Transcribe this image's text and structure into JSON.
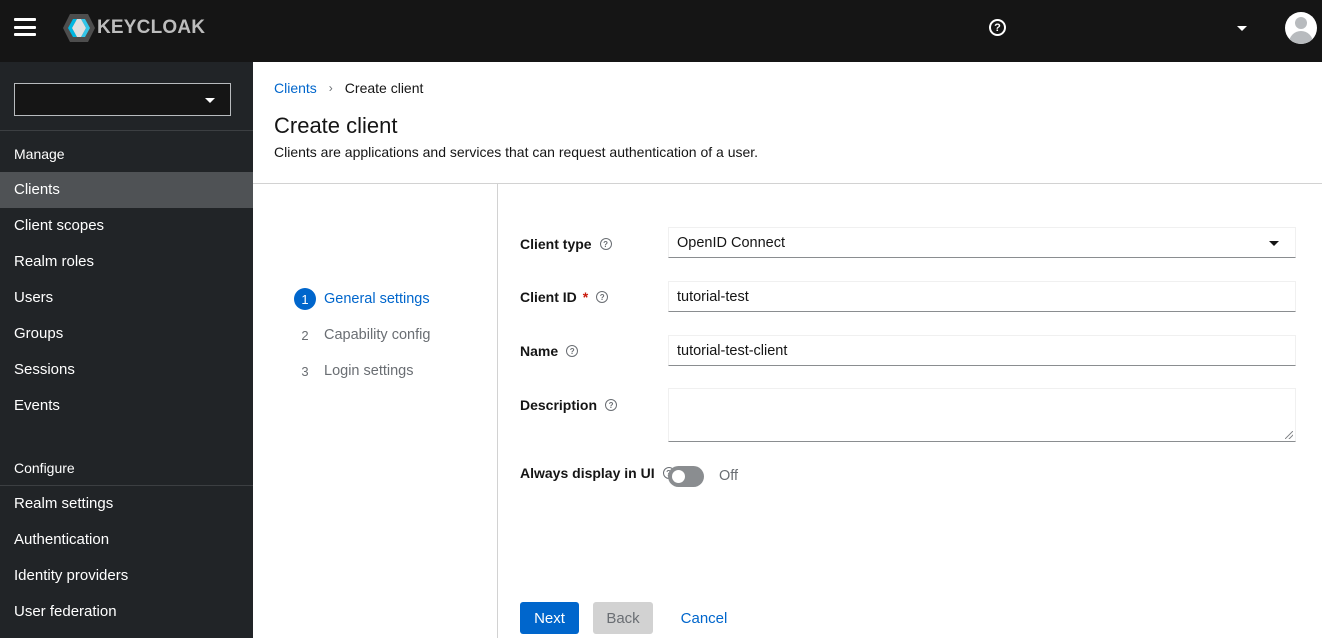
{
  "header": {
    "brand": "KEYCLOAK",
    "help_icon": "help-circle-icon",
    "user_menu_icon": "caret-down-icon",
    "avatar_icon": "user-avatar-icon"
  },
  "sidebar": {
    "realm_selector_value": "",
    "sections": [
      {
        "title": "Manage",
        "items": [
          {
            "label": "Clients",
            "active": true
          },
          {
            "label": "Client scopes"
          },
          {
            "label": "Realm roles"
          },
          {
            "label": "Users"
          },
          {
            "label": "Groups"
          },
          {
            "label": "Sessions"
          },
          {
            "label": "Events"
          }
        ]
      },
      {
        "title": "Configure",
        "items": [
          {
            "label": "Realm settings"
          },
          {
            "label": "Authentication"
          },
          {
            "label": "Identity providers"
          },
          {
            "label": "User federation"
          }
        ]
      }
    ]
  },
  "breadcrumb": {
    "parent": "Clients",
    "separator": "›",
    "current": "Create client"
  },
  "page": {
    "title": "Create client",
    "description": "Clients are applications and services that can request authentication of a user."
  },
  "wizard": {
    "steps": [
      {
        "number": "1",
        "label": "General settings",
        "current": true
      },
      {
        "number": "2",
        "label": "Capability config"
      },
      {
        "number": "3",
        "label": "Login settings"
      }
    ]
  },
  "form": {
    "client_type": {
      "label": "Client type",
      "value": "OpenID Connect"
    },
    "client_id": {
      "label": "Client ID",
      "required_mark": "*",
      "value": "tutorial-test"
    },
    "name": {
      "label": "Name",
      "value": "tutorial-test-client"
    },
    "description": {
      "label": "Description",
      "value": ""
    },
    "always_display": {
      "label": "Always display in UI",
      "state_text": "Off",
      "checked": false
    },
    "help_glyph": "?"
  },
  "actions": {
    "next": "Next",
    "back": "Back",
    "cancel": "Cancel"
  },
  "colors": {
    "accent": "#0066cc",
    "masthead": "#151515",
    "sidebar": "#212427",
    "sidebar_active": "#4f5255",
    "required": "#c9190b"
  }
}
